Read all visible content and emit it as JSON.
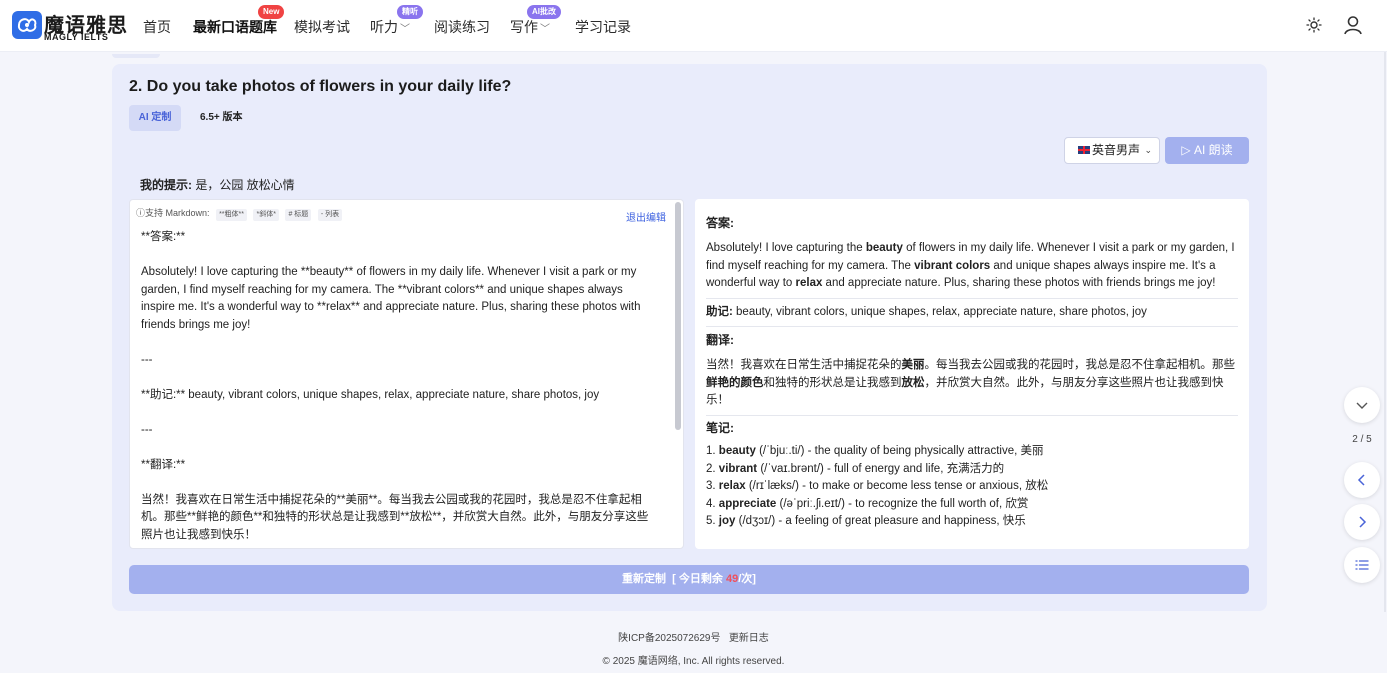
{
  "header": {
    "logo_title": "魔语雅思",
    "logo_sub": "MAGLY IELTS",
    "nav": [
      {
        "label": "首页"
      },
      {
        "label": "最新口语题库",
        "badge": "New"
      },
      {
        "label": "模拟考试"
      },
      {
        "label": "听力",
        "badge": "精听"
      },
      {
        "label": "阅读练习"
      },
      {
        "label": "写作",
        "badge": "AI批改"
      },
      {
        "label": "学习记录"
      }
    ]
  },
  "question": {
    "title": "2. Do you take photos of flowers in your daily life?",
    "tab_ai": "AI 定制",
    "tab_version": "6.5+ 版本"
  },
  "controls": {
    "voice": "英音男声",
    "read_button": "AI 朗读"
  },
  "hint": {
    "label": "我的提示:",
    "value": "是，公园 放松心情"
  },
  "editor": {
    "md_label": "支持 Markdown:",
    "md_chips": [
      "**粗体**",
      "*斜体*",
      "# 标题",
      "- 列表"
    ],
    "exit_label": "退出编辑",
    "lines": [
      "**答案:**",
      "Absolutely! I love capturing the **beauty** of flowers in my daily life. Whenever I visit a park or my garden, I find myself reaching for my camera. The **vibrant colors** and unique shapes always inspire me. It's a wonderful way to **relax** and appreciate nature. Plus, sharing these photos with friends brings me joy!",
      "---",
      "**助记:** beauty, vibrant colors, unique shapes, relax, appreciate nature, share photos, joy",
      "---",
      "**翻译:**",
      "当然！我喜欢在日常生活中捕捉花朵的**美丽**。每当我去公园或我的花园时，我总是忍不住拿起相机。那些**鲜艳的颜色**和独特的形状总是让我感到**放松**，并欣赏大自然。此外，与朋友分享这些照片也让我感到快乐！"
    ]
  },
  "preview": {
    "answer_heading": "答案:",
    "answer": {
      "t1": "Absolutely! I love capturing the ",
      "b1": "beauty",
      "t2": " of flowers in my daily life. Whenever I visit a park or my garden, I find myself reaching for my camera. The ",
      "b2": "vibrant colors",
      "t3": " and unique shapes always inspire me. It's a wonderful way to ",
      "b3": "relax",
      "t4": " and appreciate nature. Plus, sharing these photos with friends brings me joy!"
    },
    "mnemonic_label": "助记:",
    "mnemonic": " beauty, vibrant colors, unique shapes, relax, appreciate nature, share photos, joy",
    "translation_heading": "翻译:",
    "translation": {
      "t1": "当然！我喜欢在日常生活中捕捉花朵的",
      "b1": "美丽",
      "t2": "。每当我去公园或我的花园时，我总是忍不住拿起相机。那些",
      "b2": "鲜艳的颜色",
      "t3": "和独特的形状总是让我感到",
      "b3": "放松",
      "t4": "，并欣赏大自然。此外，与朋友分享这些照片也让我感到快乐！"
    },
    "notes_heading": "笔记:",
    "notes": [
      {
        "num": "1. ",
        "word": "beauty",
        "rest": " (/ˈbjuː.ti/) - the quality of being physically attractive, 美丽"
      },
      {
        "num": "2. ",
        "word": "vibrant",
        "rest": " (/ˈvaɪ.brənt/) - full of energy and life, 充满活力的"
      },
      {
        "num": "3. ",
        "word": "relax",
        "rest": " (/rɪˈlæks/) - to make or become less tense or anxious, 放松"
      },
      {
        "num": "4. ",
        "word": "appreciate",
        "rest": " (/əˈpriː.ʃi.eɪt/) - to recognize the full worth of, 欣赏"
      },
      {
        "num": "5. ",
        "word": "joy",
        "rest": " (/dʒɔɪ/) - a feeling of great pleasure and happiness, 快乐"
      }
    ]
  },
  "regen": {
    "label": "重新定制",
    "pre": "[ 今日剩余 ",
    "count": "49",
    "post": "/次]"
  },
  "footer": {
    "icp": "陕ICP备2025072629号",
    "changelog": "更新日志",
    "copyright": "© 2025 魔语网络, Inc. All rights reserved."
  },
  "pager": {
    "indicator": "2 / 5"
  },
  "colors": {
    "accent": "#a3b0ee",
    "link": "#3e62e0",
    "card_bg": "#e9ecfb",
    "badge_red": "#f04343",
    "badge_purple": "#8a74ee"
  }
}
